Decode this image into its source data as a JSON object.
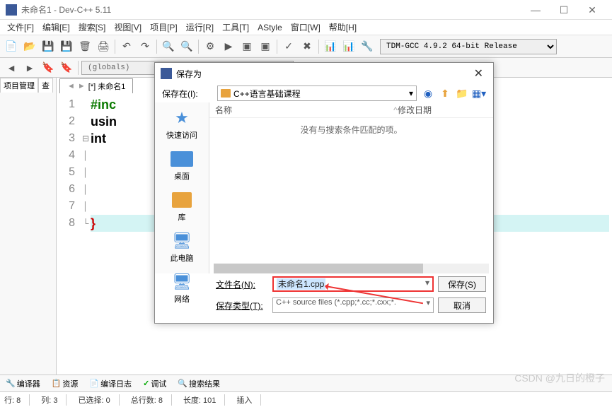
{
  "window": {
    "title": "未命名1 - Dev-C++ 5.11"
  },
  "menu": [
    "文件[F]",
    "编辑[E]",
    "搜索[S]",
    "视图[V]",
    "项目[P]",
    "运行[R]",
    "工具[T]",
    "AStyle",
    "窗口[W]",
    "帮助[H]"
  ],
  "compiler": "TDM-GCC 4.9.2 64-bit Release",
  "globals": "(globals)",
  "sidebar_tabs": [
    "项目管理",
    "查"
  ],
  "editor_tab": "[*] 未命名1",
  "code_lines": [
    {
      "n": "1",
      "text": "#inc",
      "cls": "kw-inc"
    },
    {
      "n": "2",
      "text": "usin",
      "cls": "kw-using"
    },
    {
      "n": "3",
      "text": "int ",
      "cls": "kw-int",
      "fold": "⊟"
    },
    {
      "n": "4",
      "text": ""
    },
    {
      "n": "5",
      "text": ""
    },
    {
      "n": "6",
      "text": ""
    },
    {
      "n": "7",
      "text": ""
    },
    {
      "n": "8",
      "text": "}",
      "cls": "brace",
      "hl": true,
      "fold": "└"
    }
  ],
  "dialog": {
    "title": "保存为",
    "save_in_label": "保存在(I):",
    "folder": "C++语言基础课程",
    "places": [
      {
        "label": "快速访问",
        "ico": "star"
      },
      {
        "label": "桌面",
        "ico": "desktop"
      },
      {
        "label": "库",
        "ico": "lib"
      },
      {
        "label": "此电脑",
        "ico": "pc"
      },
      {
        "label": "网络",
        "ico": "net"
      }
    ],
    "col_name": "名称",
    "col_date": "修改日期",
    "empty_msg": "没有与搜索条件匹配的项。",
    "filename_label": "文件名(N):",
    "filename_value": "未命名1.cpp",
    "filetype_label": "保存类型(T):",
    "filetype_value": "C++ source files (*.cpp;*.cc;*.cxx;*.",
    "save_btn": "保存(S)",
    "cancel_btn": "取消"
  },
  "bottom_tabs": [
    "编译器",
    "资源",
    "编译日志",
    "调试",
    "搜索结果"
  ],
  "status": {
    "line": "行: 8",
    "col": "列: 3",
    "sel": "已选择: 0",
    "total_lines": "总行数: 8",
    "length": "长度: 101",
    "insert": "插入"
  },
  "watermark": "CSDN @九日的橙子"
}
